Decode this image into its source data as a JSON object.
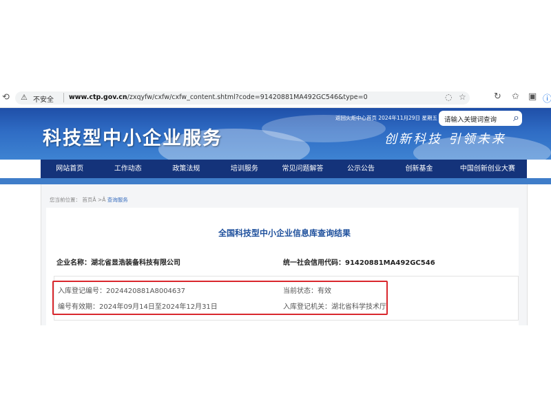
{
  "browser": {
    "security_label": "不安全",
    "url_domain": "www.ctp.gov.cn",
    "url_path": "/zxqyfw/cxfw/cxfw_content.shtml?code=91420881MA492GC546&type=0"
  },
  "site": {
    "title": "科技型中小企业服务",
    "top_links": "返回火炬中心首页   2024年11月29日 星期五",
    "search_placeholder": "请输入关键词查询",
    "slogan": "创新科技 引领未来"
  },
  "nav": {
    "items": [
      "网站首页",
      "工作动态",
      "政策法规",
      "培训服务",
      "常见问题解答",
      "公示公告",
      "创新基金",
      "中国创新创业大赛"
    ]
  },
  "breadcrumb": {
    "prefix": "您当前位置：",
    "home": "首页Â >Â",
    "current": "查询服务"
  },
  "page_title": "全国科技型中小企业信息库查询结果",
  "company": {
    "name_label": "企业名称：",
    "name": "湖北省显浩装备科技有限公司",
    "code_label": "统一社会信用代码：",
    "code": "91420881MA492GC546"
  },
  "registration": {
    "reg_no_label": "入库登记编号：",
    "reg_no": "2024420881A8004637",
    "status_label": "当前状态：",
    "status": "有效",
    "validity_label": "编号有效期：",
    "validity": "2024年09月14日至2024年12月31日",
    "authority_label": "入库登记机关：",
    "authority": "湖北省科学技术厅"
  },
  "colors": {
    "banner": "#2f6cc4",
    "navbar": "#14337a",
    "title_blue": "#1d4f9c",
    "highlight_red": "#d9262c"
  },
  "icons": [
    "back-icon",
    "warning-icon",
    "favorite-icon",
    "reload-icon",
    "collections-icon",
    "search-icon"
  ]
}
